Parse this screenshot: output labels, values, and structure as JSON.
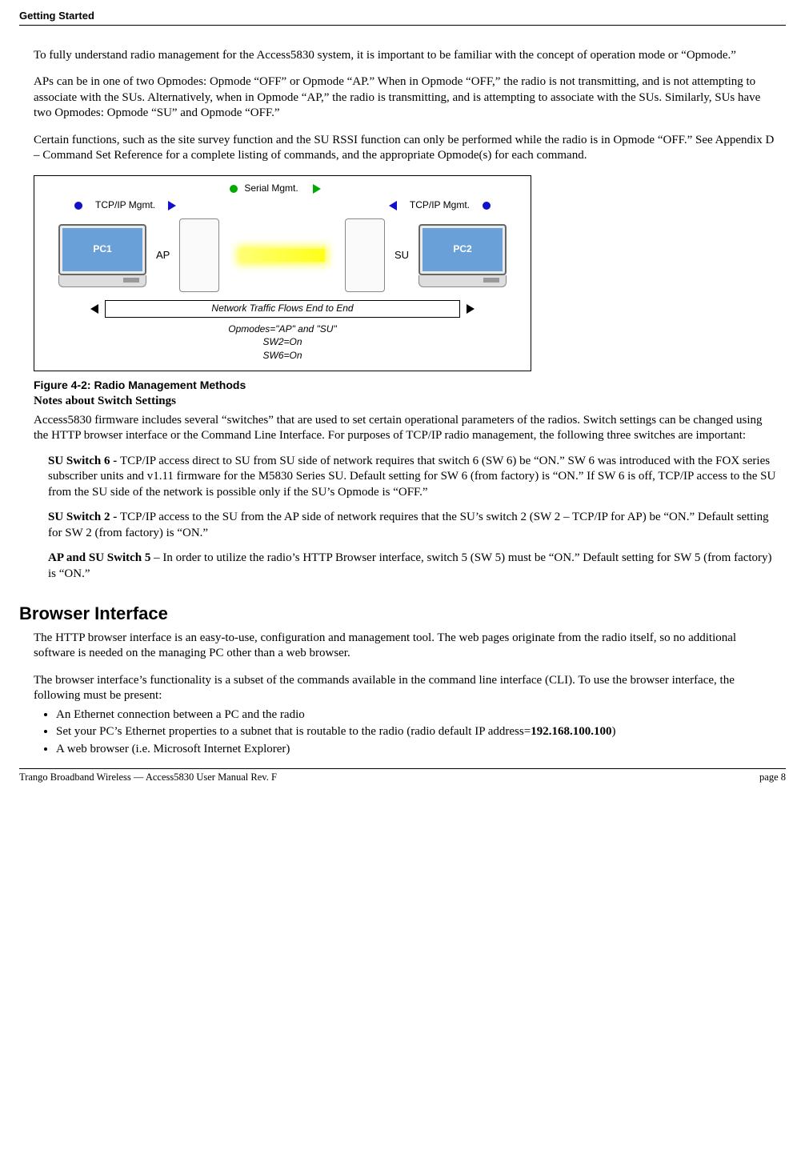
{
  "header": {
    "section": "Getting Started"
  },
  "paras": {
    "p1": "To fully understand radio management for the Access5830 system, it is important to be familiar with the concept of operation mode or “Opmode.”",
    "p2": "APs can be in one of two Opmodes: Opmode “OFF” or Opmode “AP.”   When in Opmode “OFF,” the radio is not transmitting, and is not attempting to associate with the SUs.  Alternatively, when in Opmode “AP,” the radio is transmitting, and is attempting to associate with the SUs.   Similarly, SUs have two Opmodes: Opmode “SU” and Opmode “OFF.”",
    "p3": "Certain functions, such as the site survey function and the SU RSSI function can only be performed while the radio is in Opmode “OFF.”  See Appendix D – Command Set Reference for a complete listing of commands, and the appropriate Opmode(s) for each command."
  },
  "figure": {
    "serial": "Serial Mgmt.",
    "tcp_left": "TCP/IP Mgmt.",
    "tcp_right": "TCP/IP Mgmt.",
    "pc1": "PC1",
    "pc2": "PC2",
    "ap": "AP",
    "su": "SU",
    "netflow": "Network  Traffic Flows End to End",
    "opmodes": "Opmodes=\"AP\" and \"SU\"",
    "sw2": "SW2=On",
    "sw6": "SW6=On",
    "caption": "Figure 4-2:  Radio Management Methods"
  },
  "notes": {
    "title": "Notes about Switch Settings",
    "intro": "Access5830 firmware includes several “switches” that are used to set certain operational parameters of the radios.  Switch settings can be changed using the HTTP browser interface or the Command Line Interface.  For purposes of TCP/IP radio management, the following three switches are important:",
    "sw6_name": "SU Switch 6 - ",
    "sw6_text": "TCP/IP access direct to SU from SU side of network requires that switch 6 (SW 6) be “ON.”  SW 6 was introduced with the FOX series subscriber units and v1.11 firmware for the M5830 Series SU.  Default setting for SW 6 (from factory) is “ON.”  If SW 6 is off, TCP/IP access to the SU from the SU side of the network is possible only if the SU’s Opmode is “OFF.”",
    "sw2_name": "SU Switch 2 - ",
    "sw2_text": "TCP/IP access to the SU from the AP side of network requires that the SU’s switch 2 (SW 2 – TCP/IP for AP) be “ON.”  Default setting for SW 2 (from factory) is “ON.”",
    "sw5_name": "AP and SU Switch 5",
    "sw5_text": " – In order to utilize the radio’s HTTP Browser interface, switch 5 (SW 5) must be “ON.”  Default setting for SW 5 (from factory) is “ON.”"
  },
  "browser": {
    "heading": "Browser Interface",
    "p1": "The HTTP browser interface is an easy-to-use, configuration and management tool.  The web pages originate from the radio itself, so no additional software is needed on the managing PC other than a web browser.",
    "p2": "The browser interface’s functionality is a subset of the commands available in the command line interface (CLI).  To use the browser interface, the following must be present:",
    "bullets": {
      "b1": "An Ethernet connection between a PC and the radio",
      "b2a": "Set your PC’s Ethernet properties to a subnet that is routable to the radio (radio default IP address=",
      "b2b": "192.168.100.100",
      "b2c": ")",
      "b3": "A web browser (i.e. Microsoft Internet Explorer)"
    }
  },
  "footer": {
    "left": "Trango Broadband Wireless — Access5830 User Manual  Rev. F",
    "right": "page 8"
  }
}
